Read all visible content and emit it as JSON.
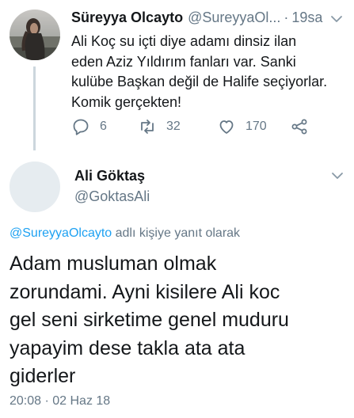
{
  "parent_tweet": {
    "display_name": "Süreyya Olcayto",
    "handle": "@SureyyaOl...",
    "separator": "·",
    "time": "19sa",
    "text_lines": [
      "Ali Koç su içti diye adamı dinsiz ilan",
      "eden Aziz Yıldırım fanları var. Sanki",
      "kulübe Başkan değil de Halife seçiyorlar.",
      "Komik gerçekten!"
    ],
    "reply_count": "6",
    "retweet_count": "32",
    "like_count": "170",
    "icons": {
      "reply": "reply-icon",
      "retweet": "retweet-icon",
      "like": "heart-icon",
      "share": "share-icon",
      "menu": "chevron-down-icon"
    }
  },
  "main_tweet": {
    "display_name": "Ali Göktaş",
    "handle": "@GoktasAli",
    "reply_to_mention": "@SureyyaOlcayto",
    "reply_to_suffix": " adlı kişiye yanıt olarak",
    "text_lines": [
      "Adam musluman olmak",
      "zorundami. Ayni kisilere Ali koc",
      "gel seni sirketime genel muduru",
      "yapayim dese takla ata ata",
      "giderler"
    ],
    "timestamp": "20:08 · 02 Haz 18"
  },
  "colors": {
    "text": "#14171a",
    "secondary": "#657786",
    "link": "#1da1f2",
    "thread_line": "#ccd6dd",
    "placeholder_avatar": "#e6ecf0"
  }
}
